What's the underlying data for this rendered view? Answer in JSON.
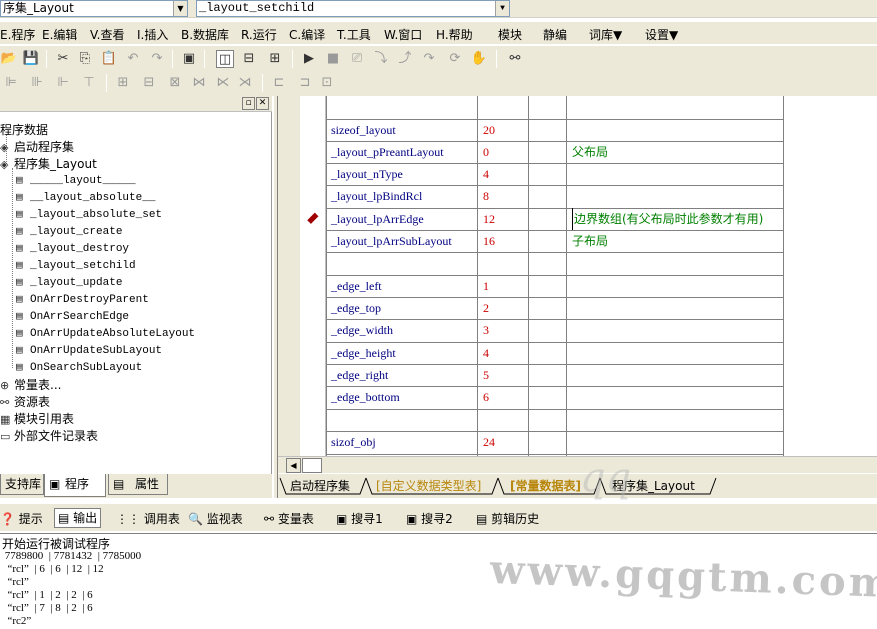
{
  "top": {
    "combo1": "序集_Layout",
    "combo2": "_layout_setchild"
  },
  "menu": [
    {
      "key": "E",
      "label": "E.程序"
    },
    {
      "key": "E",
      "label": "E.编辑"
    },
    {
      "key": "V",
      "label": "V.查看"
    },
    {
      "key": "I",
      "label": "I.插入"
    },
    {
      "key": "B",
      "label": "B.数据库"
    },
    {
      "key": "R",
      "label": "R.运行"
    },
    {
      "key": "C",
      "label": "C.编译"
    },
    {
      "key": "T",
      "label": "T.工具"
    },
    {
      "key": "W",
      "label": "W.窗口"
    },
    {
      "key": "H",
      "label": "H.帮助"
    },
    {
      "key": "",
      "label": "模块"
    },
    {
      "key": "",
      "label": "静编"
    },
    {
      "key": "",
      "label": "词库▼"
    },
    {
      "key": "",
      "label": "设置▼"
    }
  ],
  "toolbar_icons": [
    "open-icon",
    "save-icon",
    "cut-icon",
    "copy-icon",
    "paste-icon",
    "undo-icon",
    "redo-icon",
    "find-icon",
    "layout1-icon",
    "layout2-icon",
    "layout3-icon",
    "run-icon",
    "stop-icon",
    "step-icon",
    "step-into-icon",
    "step-out-icon",
    "step-over-icon",
    "breakpoint-icon",
    "hand-icon",
    "binoculars-icon"
  ],
  "tree": {
    "root": "程序数据",
    "items": [
      {
        "label": "启动程序集",
        "icon": "set-icon",
        "level": 1
      },
      {
        "label": "程序集_Layout",
        "icon": "set-icon",
        "level": 1
      },
      {
        "label": "_____layout_____",
        "icon": "sub-icon",
        "level": 2
      },
      {
        "label": "__layout_absolute__",
        "icon": "sub-icon",
        "level": 2
      },
      {
        "label": "_layout_absolute_set",
        "icon": "sub-icon",
        "level": 2
      },
      {
        "label": "_layout_create",
        "icon": "sub-icon",
        "level": 2
      },
      {
        "label": "_layout_destroy",
        "icon": "sub-icon",
        "level": 2
      },
      {
        "label": "_layout_setchild",
        "icon": "sub-icon",
        "level": 2
      },
      {
        "label": "_layout_update",
        "icon": "sub-icon",
        "level": 2
      },
      {
        "label": "OnArrDestroyParent",
        "icon": "sub-icon",
        "level": 2
      },
      {
        "label": "OnArrSearchEdge",
        "icon": "sub-icon",
        "level": 2
      },
      {
        "label": "OnArrUpdateAbsoluteLayout",
        "icon": "sub-icon",
        "level": 2
      },
      {
        "label": "OnArrUpdateSubLayout",
        "icon": "sub-icon",
        "level": 2
      },
      {
        "label": "OnSearchSubLayout",
        "icon": "sub-icon",
        "level": 2
      },
      {
        "label": "常量表...",
        "icon": "const-icon",
        "level": 0
      },
      {
        "label": "资源表",
        "icon": "resource-icon",
        "level": 0
      },
      {
        "label": "模块引用表",
        "icon": "module-icon",
        "level": 0
      },
      {
        "label": "外部文件记录表",
        "icon": "file-icon",
        "level": 0
      }
    ]
  },
  "left_tabs": [
    "支持库",
    "程序",
    "属性"
  ],
  "constants": [
    {
      "name": "",
      "value": "",
      "note": ""
    },
    {
      "name": "sizeof_layout",
      "value": "20",
      "note": ""
    },
    {
      "name": "_layout_pPreantLayout",
      "value": "0",
      "note": "父布局"
    },
    {
      "name": "_layout_nType",
      "value": "4",
      "note": ""
    },
    {
      "name": "_layout_lpBindRcl",
      "value": "8",
      "note": ""
    },
    {
      "name": "_layout_lpArrEdge",
      "value": "12",
      "note": "边界数组(有父布局时此参数才有用)"
    },
    {
      "name": "_layout_lpArrSubLayout",
      "value": "16",
      "note": "子布局"
    },
    {
      "name": "",
      "value": "",
      "note": ""
    },
    {
      "name": "_edge_left",
      "value": "1",
      "note": ""
    },
    {
      "name": "_edge_top",
      "value": "2",
      "note": ""
    },
    {
      "name": "_edge_width",
      "value": "3",
      "note": ""
    },
    {
      "name": "_edge_height",
      "value": "4",
      "note": ""
    },
    {
      "name": "_edge_right",
      "value": "5",
      "note": ""
    },
    {
      "name": "_edge_bottom",
      "value": "6",
      "note": ""
    },
    {
      "name": "",
      "value": "",
      "note": ""
    },
    {
      "name": "sizof_obj",
      "value": "24",
      "note": ""
    }
  ],
  "editor_tabs": [
    {
      "label": "启动程序集",
      "color": "#000000"
    },
    {
      "label": "[自定义数据类型表]",
      "color": "#b8860b"
    },
    {
      "label": "[常量数据表]",
      "color": "#b8860b"
    },
    {
      "label": "程序集_Layout",
      "color": "#000000"
    }
  ],
  "bottom_tabs": [
    "提示",
    "输出",
    "调用表",
    "监视表",
    "变量表",
    "搜寻1",
    "搜寻2",
    "剪辑历史"
  ],
  "output_lines": [
    "开始运行被调试程序",
    " 7789800  | 7781432  | 7785000",
    "  “rcl”  | 6  | 6  | 12  | 12",
    "  “rcl”",
    "  “rcl”  | 1  | 2  | 2  | 6",
    "  “rcl”  | 7  | 8  | 2  | 6",
    "  “rc2”"
  ],
  "watermark": "www.gqgtm.com",
  "watermark_script": "qq"
}
